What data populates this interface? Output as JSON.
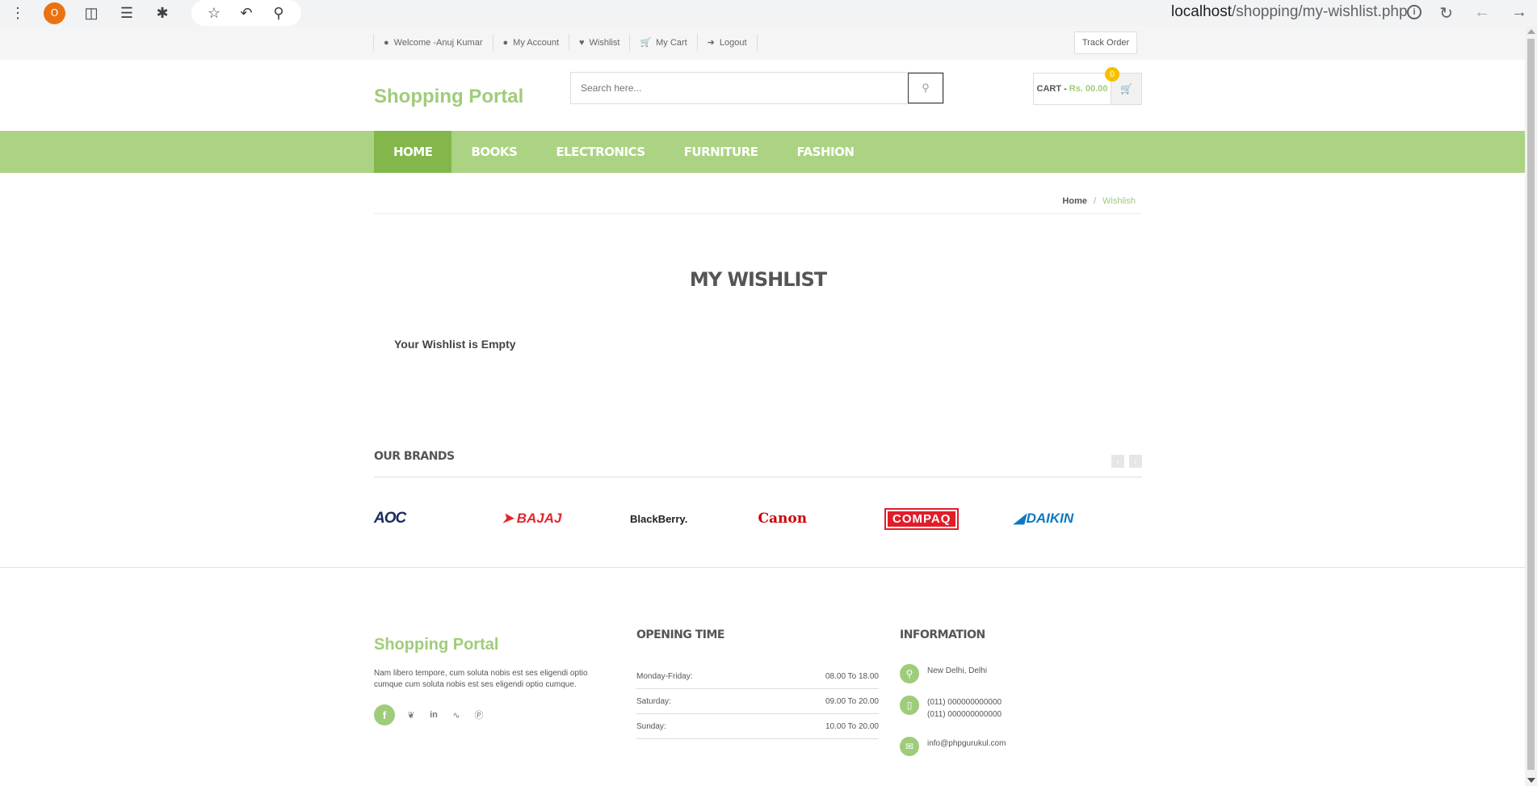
{
  "browser": {
    "profile_initial": "O",
    "url_host": "localhost",
    "url_path": "/shopping/my-wishlist.php"
  },
  "topbar": {
    "links": [
      "Welcome -Anuj Kumar",
      "My Account",
      "Wishlist",
      "My Cart",
      "Logout"
    ],
    "track_order": "Track Order"
  },
  "header": {
    "logo": "Shopping Portal",
    "search_placeholder": "Search here...",
    "cart_label": "CART -",
    "cart_amount": "Rs. 00.00",
    "cart_count": "0"
  },
  "nav": {
    "items": [
      "HOME",
      "BOOKS",
      "ELECTRONICS",
      "FURNITURE",
      "FASHION"
    ]
  },
  "breadcrumb": {
    "home": "Home",
    "separator": "/",
    "current": "Wishlish"
  },
  "wishlist": {
    "title": "MY WISHLIST",
    "empty_message": "Your Wishlist is Empty"
  },
  "brands": {
    "heading": "OUR BRANDS",
    "logos": [
      "AOC",
      "BAJAJ",
      "BlackBerry.",
      "Canon",
      "COMPAQ",
      "DAIKIN"
    ]
  },
  "footer": {
    "logo": "Shopping Portal",
    "about": "Nam libero tempore, cum soluta nobis est ses eligendi optio cumque cum soluta nobis est ses eligendi optio cumque.",
    "opening_heading": "OPENING TIME",
    "hours": [
      {
        "day": "Monday-Friday:",
        "time": "08.00 To 18.00"
      },
      {
        "day": "Saturday:",
        "time": "09.00 To 20.00"
      },
      {
        "day": "Sunday:",
        "time": "10.00 To 20.00"
      }
    ],
    "info_heading": "INFORMATION",
    "address": "New Delhi, Delhi",
    "phone1": "(011) 000000000000",
    "phone2": "(011) 000000000000",
    "email": "info@phpgurukul.com"
  },
  "colors": {
    "accent_green": "#9fcc7a",
    "nav_green": "#abd383",
    "nav_active": "#83b74b"
  }
}
